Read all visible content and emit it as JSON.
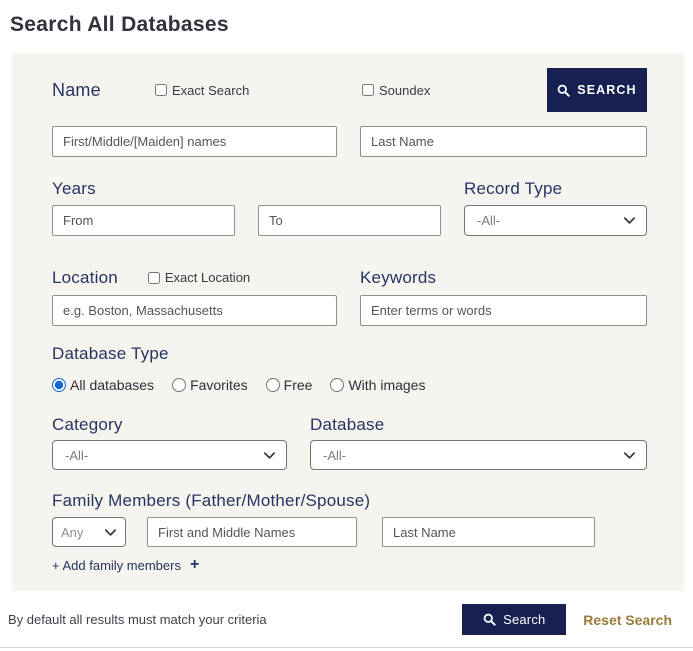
{
  "page": {
    "title": "Search All Databases"
  },
  "form": {
    "name_section": {
      "label": "Name",
      "exact_search_label": "Exact Search",
      "exact_search_checked": false,
      "soundex_label": "Soundex",
      "soundex_checked": false,
      "first_placeholder": "First/Middle/[Maiden] names",
      "last_placeholder": "Last Name"
    },
    "top_search_button": "SEARCH",
    "years_section": {
      "label": "Years",
      "from_placeholder": "From",
      "to_placeholder": "To"
    },
    "record_type_section": {
      "label": "Record Type",
      "selected": "-All-"
    },
    "location_section": {
      "label": "Location",
      "exact_location_label": "Exact Location",
      "exact_location_checked": false,
      "placeholder": "e.g. Boston, Massachusetts"
    },
    "keywords_section": {
      "label": "Keywords",
      "placeholder": "Enter terms or words"
    },
    "database_type_section": {
      "label": "Database Type",
      "options": [
        {
          "label": "All databases",
          "selected": true
        },
        {
          "label": "Favorites",
          "selected": false
        },
        {
          "label": "Free",
          "selected": false
        },
        {
          "label": "With images",
          "selected": false
        }
      ]
    },
    "category_section": {
      "label": "Category",
      "selected": "-All-"
    },
    "database_section": {
      "label": "Database",
      "selected": "-All-"
    },
    "family_section": {
      "label": "Family Members (Father/Mother/Spouse)",
      "relation_selected": "Any",
      "first_placeholder": "First and Middle Names",
      "last_placeholder": "Last Name",
      "add_link": "+ Add family members",
      "add_icon": "+"
    },
    "bottom": {
      "note": "By default all results must match your criteria",
      "search_button": "Search",
      "reset_link": "Reset Search"
    }
  },
  "icons": {
    "search": "magnifier-icon",
    "chevron": "chevron-down-icon",
    "plus": "plus-icon"
  },
  "colors": {
    "button_navy": "#162051",
    "label_navy": "#263462",
    "panel_bg": "#f6f4ef",
    "reset_gold": "#9a7b3a",
    "radio_blue": "#1566d6"
  }
}
